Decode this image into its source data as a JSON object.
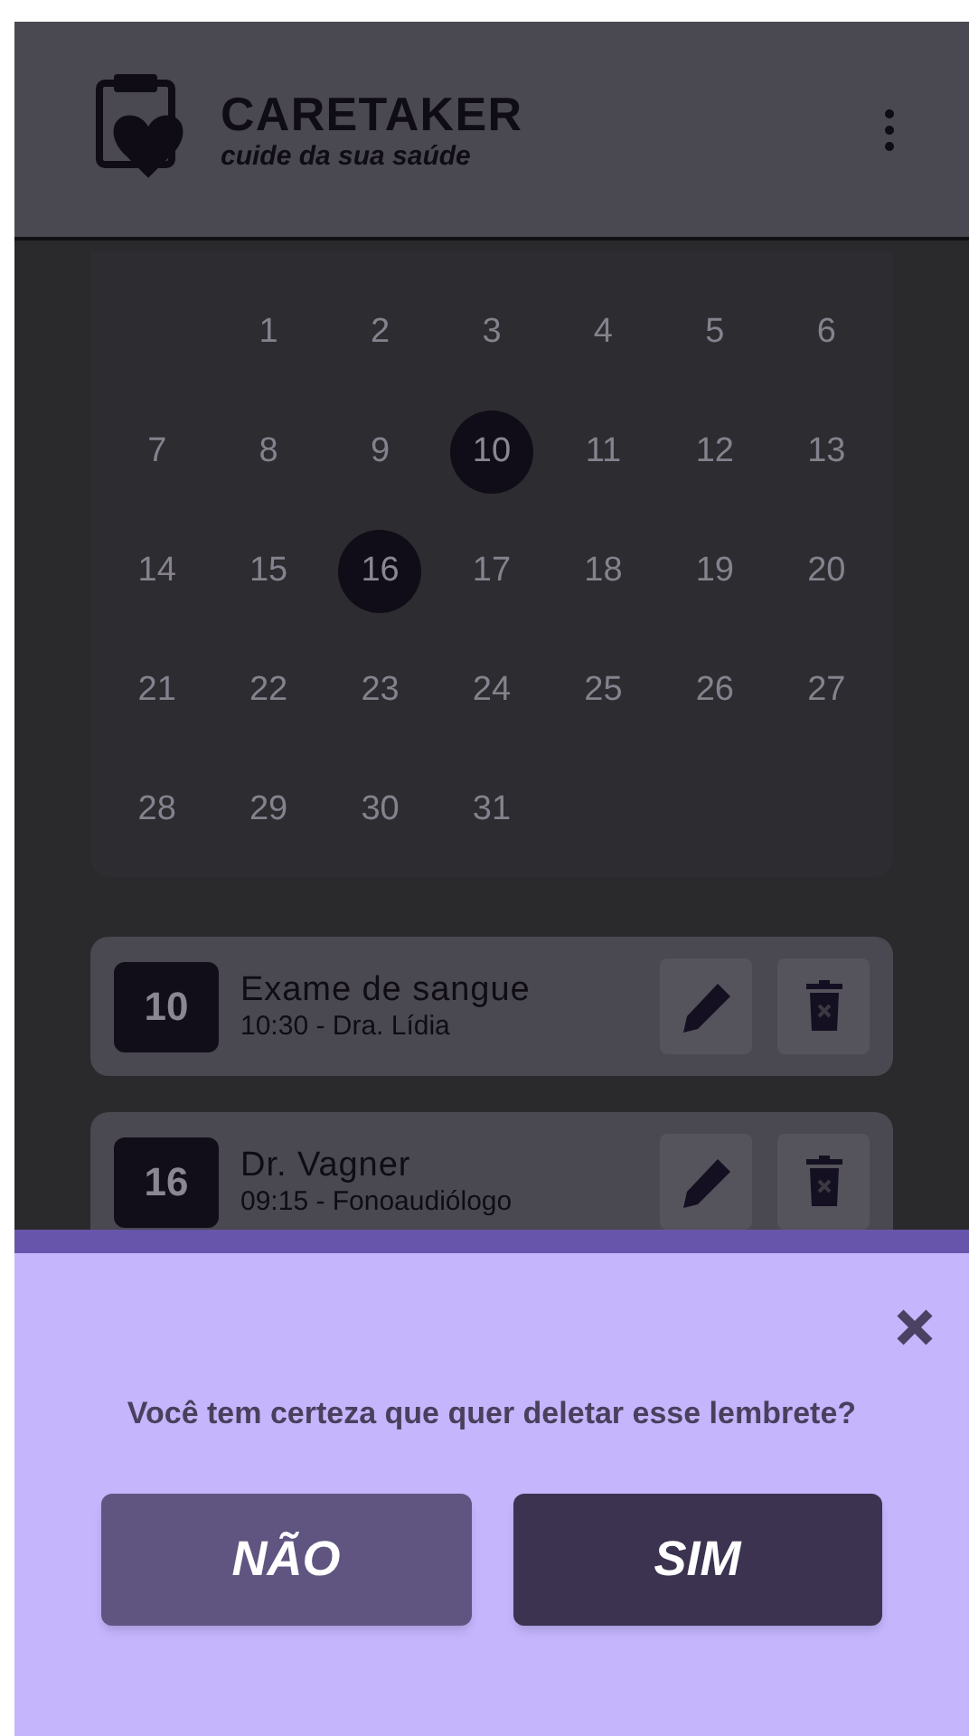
{
  "header": {
    "title": "CARETAKER",
    "subtitle": "cuide da sua saúde"
  },
  "calendar": {
    "weeks": [
      [
        {
          "day": "1",
          "marked": false
        },
        {
          "day": "2",
          "marked": false
        },
        {
          "day": "3",
          "marked": false
        },
        {
          "day": "4",
          "marked": false
        },
        {
          "day": "5",
          "marked": false
        },
        {
          "day": "6",
          "marked": false
        }
      ],
      [
        {
          "day": "7",
          "marked": false
        },
        {
          "day": "8",
          "marked": false
        },
        {
          "day": "9",
          "marked": false
        },
        {
          "day": "10",
          "marked": true
        },
        {
          "day": "11",
          "marked": false
        },
        {
          "day": "12",
          "marked": false
        },
        {
          "day": "13",
          "marked": false
        }
      ],
      [
        {
          "day": "14",
          "marked": false
        },
        {
          "day": "15",
          "marked": false
        },
        {
          "day": "16",
          "marked": true
        },
        {
          "day": "17",
          "marked": false
        },
        {
          "day": "18",
          "marked": false
        },
        {
          "day": "19",
          "marked": false
        },
        {
          "day": "20",
          "marked": false
        }
      ],
      [
        {
          "day": "21",
          "marked": false
        },
        {
          "day": "22",
          "marked": false
        },
        {
          "day": "23",
          "marked": false
        },
        {
          "day": "24",
          "marked": false
        },
        {
          "day": "25",
          "marked": false
        },
        {
          "day": "26",
          "marked": false
        },
        {
          "day": "27",
          "marked": false
        }
      ],
      [
        {
          "day": "28",
          "marked": false
        },
        {
          "day": "29",
          "marked": false
        },
        {
          "day": "30",
          "marked": false
        },
        {
          "day": "31",
          "marked": false
        }
      ]
    ]
  },
  "reminders": [
    {
      "day": "10",
      "title": "Exame de sangue",
      "detail": "10:30 - Dra. Lídia"
    },
    {
      "day": "16",
      "title": "Dr. Vagner",
      "detail": "09:15 - Fonoaudiólogo"
    }
  ],
  "dialog": {
    "message": "Você tem certeza que quer deletar esse lembrete?",
    "buttons": [
      {
        "label": "NÃO",
        "kind": "secondary"
      },
      {
        "label": "SIM",
        "kind": "primary"
      }
    ]
  }
}
